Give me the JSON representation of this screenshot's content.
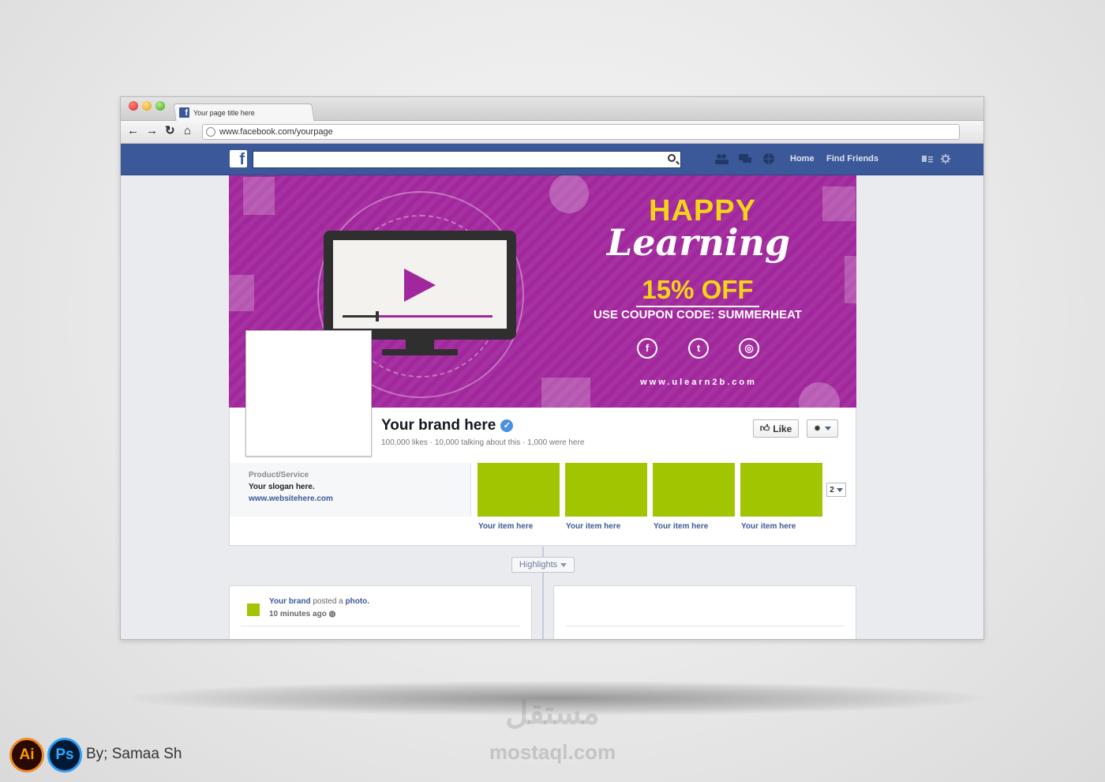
{
  "browser": {
    "tab_title": "Your page title here",
    "url": "www.facebook.com/yourpage",
    "nav": [
      "back",
      "forward",
      "reload",
      "home"
    ]
  },
  "fb_header": {
    "logo": "f",
    "home_label": "Home",
    "find_friends_label": "Find Friends"
  },
  "cover": {
    "headline": "HAPPY",
    "script": "Learning",
    "discount": "15%  OFF",
    "coupon": "USE COUPON CODE: SUMMERHEAT",
    "website": "www.ulearn2b.com",
    "social_icons": [
      "facebook-icon",
      "twitter-icon",
      "instagram-icon"
    ],
    "colors": {
      "background": "#a1279c",
      "accent": "#f4d418"
    }
  },
  "page_info": {
    "name": "Your brand here",
    "stats": "100,000 likes · 10,000 talking about this · 1,000 were here",
    "like_label": "Like"
  },
  "about": {
    "category": "Product/Service",
    "slogan": "Your slogan here.",
    "website": "www.websitehere.com"
  },
  "apps": [
    {
      "label": "Your item here"
    },
    {
      "label": "Your item here"
    },
    {
      "label": "Your item here"
    },
    {
      "label": "Your item here"
    }
  ],
  "apps_more_count": "2",
  "timeline": {
    "highlights_label": "Highlights",
    "post": {
      "author": "Your brand",
      "action": " posted a ",
      "object": "photo.",
      "time": "10 minutes ago"
    }
  },
  "credits": {
    "ai_label": "Ai",
    "ps_label": "Ps",
    "author": "By; Samaa Sh",
    "watermark": "mostaql.com",
    "watermark_logo": "مستقل"
  }
}
